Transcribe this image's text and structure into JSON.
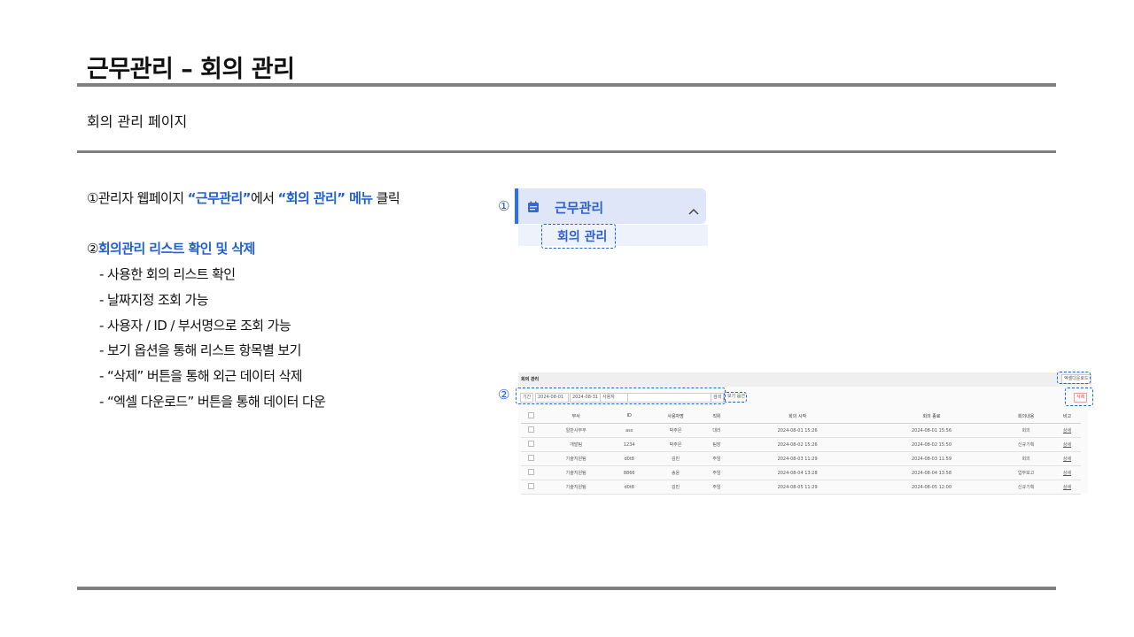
{
  "title": "근무관리 – 회의 관리",
  "subtitle": "회의 관리  페이지",
  "step1": {
    "num": "①",
    "pre": "관리자 웹페이지 ",
    "hl1": "“근무관리”",
    "mid": "에서 ",
    "hl2": "“회의 관리” 메뉴",
    "post": " 클릭"
  },
  "step2": {
    "num": "②",
    "label": "회의관리 리스트 확인 및 삭제",
    "bullets": [
      "- 사용한 회의 리스트 확인",
      "- 날짜지정 조회 가능",
      "- 사용자 / ID / 부서명으로 조회 가능",
      "- 보기 옵션을 통해 리스트 항목별 보기",
      "- “삭제” 버튼을 통해 외근 데이터 삭제",
      "- “엑셀 다운로드” 버튼을 통해 데이터 다운"
    ]
  },
  "menu": {
    "marker": "①",
    "main_label": "근무관리",
    "sub_label": "회의 관리",
    "icon": "calendar-icon",
    "chevron": "chevron-up-icon"
  },
  "list_panel": {
    "marker": "②",
    "heading": "회의 관리",
    "excel_button": "엑셀다운로드",
    "delete_button": "삭제",
    "filter_type": "기간",
    "date_from": "2024-08-01",
    "date_to": "2024-08-31",
    "select_value": "사용자",
    "search_button": "검색",
    "view_option": "보기 옵션",
    "columns": [
      "",
      "부서",
      "ID",
      "사용자명",
      "직위",
      "회의 시작",
      "회의 종료",
      "회의내용",
      "비고"
    ],
    "rows": [
      {
        "dept": "일반사무부",
        "id": "ass",
        "user": "박주은",
        "rank": "대리",
        "start": "2024-08-01 15:26",
        "end": "2024-08-01 15:56",
        "content": "회의",
        "link": "상세"
      },
      {
        "dept": "개발팀",
        "id": "1234",
        "user": "박주은",
        "rank": "팀장",
        "start": "2024-08-02 15:26",
        "end": "2024-08-02 15:50",
        "content": "신규기획",
        "link": "상세"
      },
      {
        "dept": "기술지원팀",
        "id": "d0t8",
        "user": "김민",
        "rank": "주임",
        "start": "2024-08-03 11:29",
        "end": "2024-08-03 11:59",
        "content": "회의",
        "link": "상세"
      },
      {
        "dept": "기술지원팀",
        "id": "8866",
        "user": "송윤",
        "rank": "주임",
        "start": "2024-08-04 13:28",
        "end": "2024-08-04 13:58",
        "content": "업무보고",
        "link": "상세"
      },
      {
        "dept": "기술지원팀",
        "id": "d0t8",
        "user": "김민",
        "rank": "주임",
        "start": "2024-08-05 11:29",
        "end": "2024-08-05 12:00",
        "content": "신규기획",
        "link": "상세"
      }
    ]
  },
  "colors": {
    "accent": "#1f5fd1",
    "rule": "#7f7f7f",
    "menu_bg": "#dfe6f8",
    "delete_red": "#e04545"
  }
}
